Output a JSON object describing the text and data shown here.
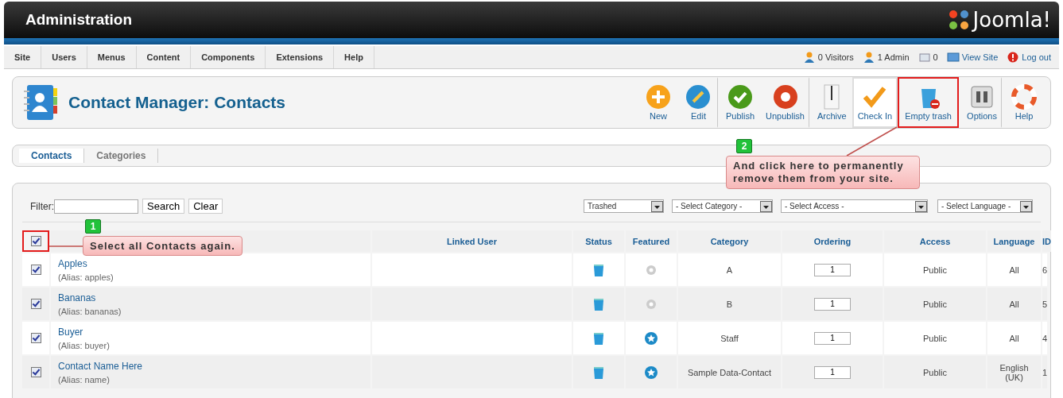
{
  "header": {
    "title": "Administration",
    "logo": "Joomla!"
  },
  "menu": [
    "Site",
    "Users",
    "Menus",
    "Content",
    "Components",
    "Extensions",
    "Help"
  ],
  "status": [
    {
      "kind": "visitors",
      "label": "0 Visitors"
    },
    {
      "kind": "admins",
      "label": "1 Admin"
    },
    {
      "kind": "messages",
      "label": "0"
    },
    {
      "kind": "view",
      "label": "View Site"
    },
    {
      "kind": "logout",
      "label": "Log out"
    }
  ],
  "page_title": "Contact Manager: Contacts",
  "toolbar": [
    {
      "kind": "new",
      "label": "New",
      "hovered": false,
      "highlighted": false,
      "group_end": false
    },
    {
      "kind": "edit",
      "label": "Edit",
      "hovered": false,
      "highlighted": false,
      "group_end": true
    },
    {
      "kind": "publish",
      "label": "Publish",
      "hovered": false,
      "highlighted": false,
      "group_end": false
    },
    {
      "kind": "unpublish",
      "label": "Unpublish",
      "hovered": false,
      "highlighted": false,
      "group_end": true
    },
    {
      "kind": "archive",
      "label": "Archive",
      "hovered": false,
      "highlighted": false,
      "group_end": false
    },
    {
      "kind": "checkin",
      "label": "Check In",
      "hovered": true,
      "highlighted": false,
      "group_end": false
    },
    {
      "kind": "trash",
      "label": "Empty trash",
      "hovered": false,
      "highlighted": true,
      "group_end": true
    },
    {
      "kind": "options",
      "label": "Options",
      "hovered": false,
      "highlighted": false,
      "group_end": true
    },
    {
      "kind": "help",
      "label": "Help",
      "hovered": false,
      "highlighted": false,
      "group_end": false
    }
  ],
  "tabs": [
    {
      "label": "Contacts",
      "selected": true
    },
    {
      "label": "Categories",
      "selected": false
    }
  ],
  "filter": {
    "label": "Filter:",
    "search": "Search",
    "clear": "Clear"
  },
  "selects": [
    "Trashed",
    "- Select Category -",
    "- Select Access -",
    "- Select Language -"
  ],
  "table": {
    "select_all": {
      "checked": true,
      "highlighted": true
    },
    "columns": [
      "Linked User",
      "Status",
      "Featured",
      "Category",
      "Ordering",
      "Access",
      "Language",
      "ID"
    ],
    "rows": [
      {
        "checked": true,
        "title": "Apples",
        "alias": "(Alias: apples)",
        "trashed": true,
        "featured": false,
        "category": "A",
        "ordering": "1",
        "access": "Public",
        "language": "All",
        "id": "6"
      },
      {
        "checked": true,
        "title": "Bananas",
        "alias": "(Alias: bananas)",
        "trashed": true,
        "featured": false,
        "category": "B",
        "ordering": "1",
        "access": "Public",
        "language": "All",
        "id": "5"
      },
      {
        "checked": true,
        "title": "Buyer",
        "alias": "(Alias: buyer)",
        "trashed": true,
        "featured": true,
        "category": "Staff",
        "ordering": "1",
        "access": "Public",
        "language": "All",
        "id": "4"
      },
      {
        "checked": true,
        "title": "Contact Name Here",
        "alias": "(Alias: name)",
        "trashed": true,
        "featured": true,
        "category": "Sample Data-Contact",
        "ordering": "1",
        "access": "Public",
        "language": "English (UK)",
        "id": "1"
      }
    ]
  },
  "annotations": [
    {
      "number": "1",
      "text": "Select all Contacts again."
    },
    {
      "number": "2",
      "text": "And click here to permanently remove them from your site."
    }
  ]
}
